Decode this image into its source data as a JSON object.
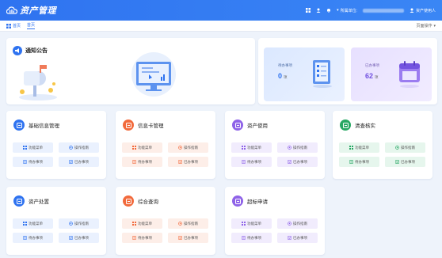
{
  "header": {
    "app_title": "资产管理",
    "unit_label": "所属单位:",
    "user_label": "资产使用人"
  },
  "tabs": {
    "home_label": "首页",
    "current_label": "首页",
    "ops_label": "页面操作"
  },
  "notice": {
    "title": "通知公告"
  },
  "stats": {
    "todo": {
      "label": "待办事项",
      "value": "0",
      "unit": "项"
    },
    "done": {
      "label": "已办事项",
      "value": "62",
      "unit": "项"
    }
  },
  "modules": [
    {
      "title": "基础信息管理",
      "color": "#2f73f0"
    },
    {
      "title": "信息卡管理",
      "color": "#f26a3c"
    },
    {
      "title": "资产使用",
      "color": "#8f63e8"
    },
    {
      "title": "清查核实",
      "color": "#27a763"
    },
    {
      "title": "资产处置",
      "color": "#2f73f0"
    },
    {
      "title": "综合查询",
      "color": "#f26a3c"
    },
    {
      "title": "超标申请",
      "color": "#8f63e8"
    }
  ],
  "module_buttons": {
    "func_menu": "功能菜单",
    "op_guide": "操作指南",
    "todo": "待办事项",
    "done": "已办事项"
  },
  "colors": {
    "primary": "#2f73f0",
    "orange": "#f26a3c",
    "purple": "#8f63e8",
    "green": "#27a763"
  }
}
